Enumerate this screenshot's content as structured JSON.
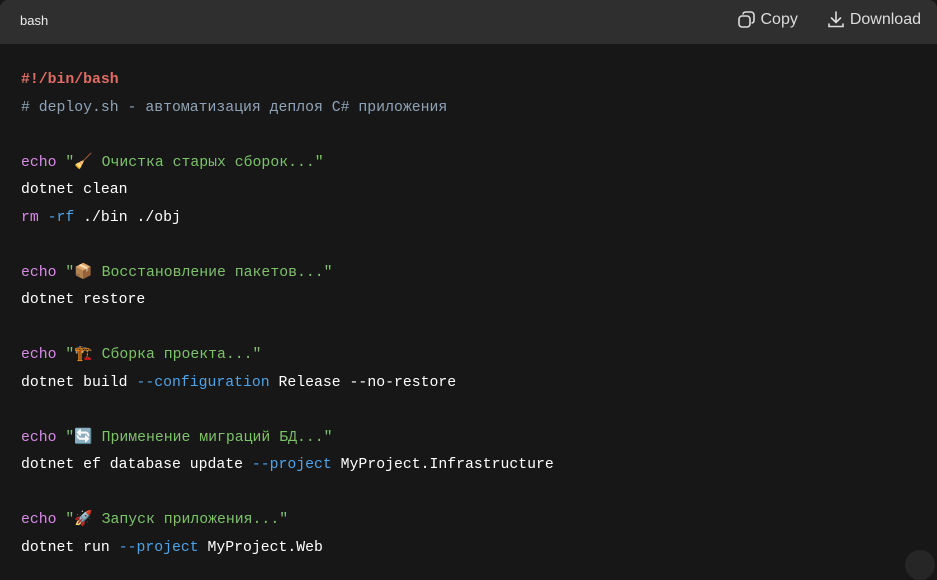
{
  "header": {
    "language": "bash",
    "copy_label": "Copy",
    "download_label": "Download"
  },
  "code_lines": [
    [
      {
        "c": "shebang",
        "t": "#!/bin/bash"
      }
    ],
    [
      {
        "c": "comment",
        "t": "# deploy.sh - автоматизация деплоя C# приложения"
      }
    ],
    [],
    [
      {
        "c": "kw",
        "t": "echo"
      },
      {
        "c": "plain",
        "t": " "
      },
      {
        "c": "str",
        "t": "\"🧹 Очистка старых сборок...\""
      }
    ],
    [
      {
        "c": "plain",
        "t": "dotnet clean"
      }
    ],
    [
      {
        "c": "kw",
        "t": "rm"
      },
      {
        "c": "plain",
        "t": " "
      },
      {
        "c": "flag",
        "t": "-rf"
      },
      {
        "c": "plain",
        "t": " ./bin ./obj"
      }
    ],
    [],
    [
      {
        "c": "kw",
        "t": "echo"
      },
      {
        "c": "plain",
        "t": " "
      },
      {
        "c": "str",
        "t": "\"📦 Восстановление пакетов...\""
      }
    ],
    [
      {
        "c": "plain",
        "t": "dotnet restore"
      }
    ],
    [],
    [
      {
        "c": "kw",
        "t": "echo"
      },
      {
        "c": "plain",
        "t": " "
      },
      {
        "c": "str",
        "t": "\"🏗️ Сборка проекта...\""
      }
    ],
    [
      {
        "c": "plain",
        "t": "dotnet build "
      },
      {
        "c": "flag",
        "t": "--configuration"
      },
      {
        "c": "plain",
        "t": " Release --no-restore"
      }
    ],
    [],
    [
      {
        "c": "kw",
        "t": "echo"
      },
      {
        "c": "plain",
        "t": " "
      },
      {
        "c": "str",
        "t": "\"🔄 Применение миграций БД...\""
      }
    ],
    [
      {
        "c": "plain",
        "t": "dotnet ef database update "
      },
      {
        "c": "flag",
        "t": "--project"
      },
      {
        "c": "plain",
        "t": " MyProject.Infrastructure"
      }
    ],
    [],
    [
      {
        "c": "kw",
        "t": "echo"
      },
      {
        "c": "plain",
        "t": " "
      },
      {
        "c": "str",
        "t": "\"🚀 Запуск приложения...\""
      }
    ],
    [
      {
        "c": "plain",
        "t": "dotnet run "
      },
      {
        "c": "flag",
        "t": "--project"
      },
      {
        "c": "plain",
        "t": " MyProject.Web"
      }
    ]
  ]
}
